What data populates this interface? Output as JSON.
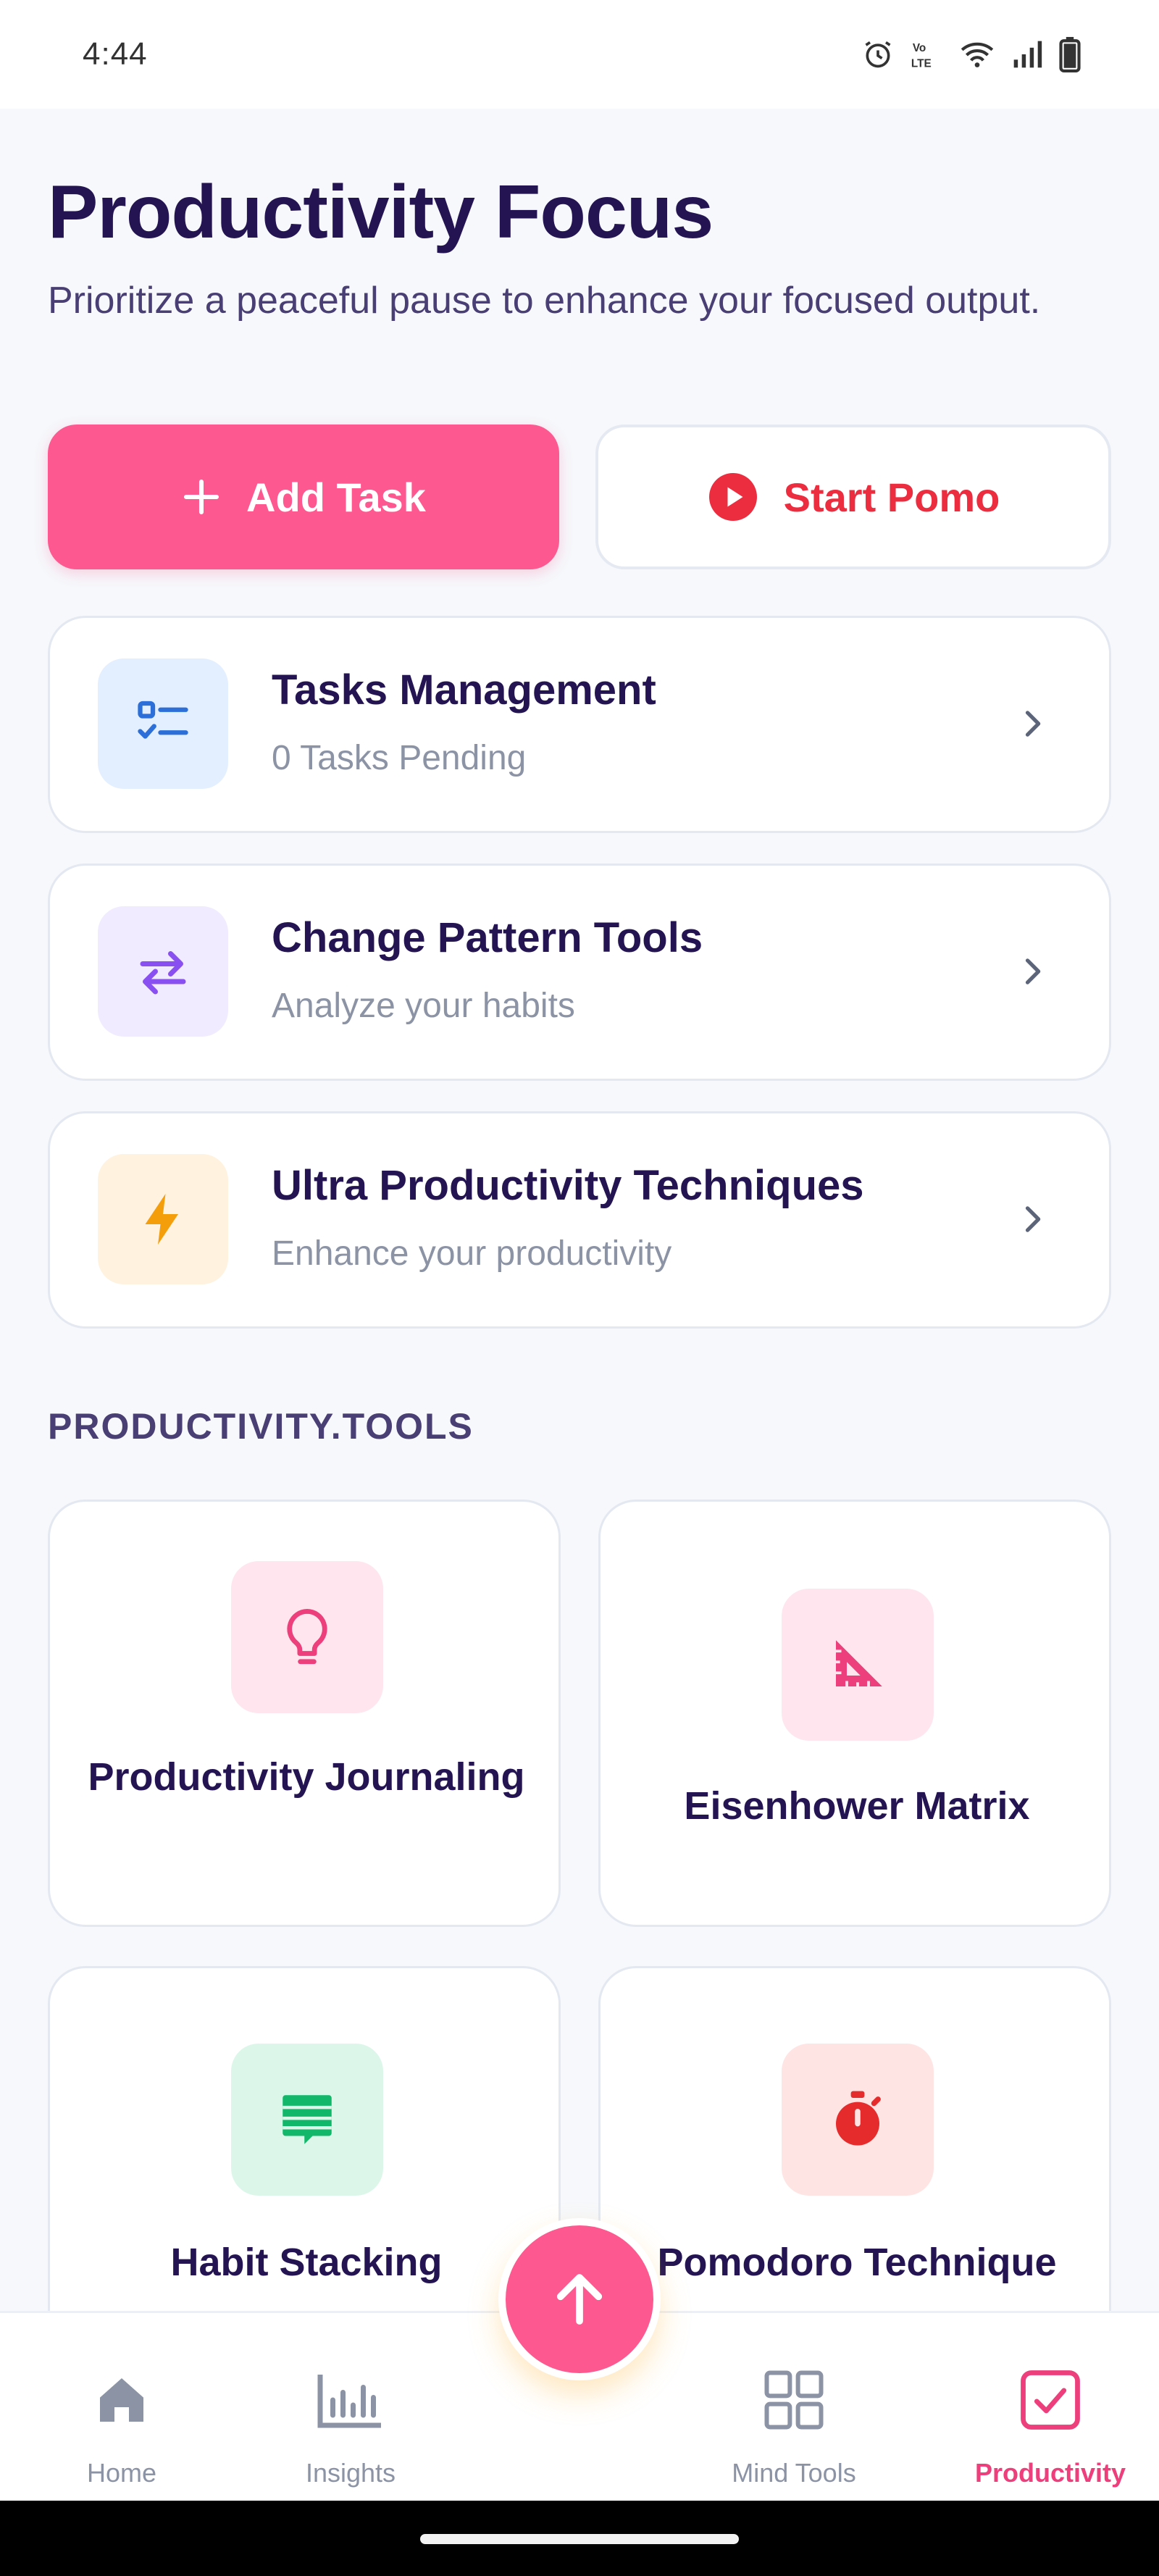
{
  "status_bar": {
    "time": "4:44",
    "icons": [
      "alarm-icon",
      "volte-icon",
      "wifi-icon",
      "signal-icon",
      "battery-icon"
    ]
  },
  "header": {
    "title": "Productivity Focus",
    "subtitle": "Prioritize a peaceful pause to enhance your focused output."
  },
  "actions": {
    "add_task_label": "Add Task",
    "start_pomo_label": "Start Pomo"
  },
  "nav_cards": [
    {
      "title": "Tasks Management",
      "subtitle": "0 Tasks Pending",
      "icon": "checklist-icon",
      "icon_bg": "#e3efff",
      "icon_color": "#2c6fd8"
    },
    {
      "title": "Change Pattern Tools",
      "subtitle": "Analyze your habits",
      "icon": "swap-arrows-icon",
      "icon_bg": "#f1ebff",
      "icon_color": "#8a4ff0"
    },
    {
      "title": "Ultra Productivity Techniques",
      "subtitle": "Enhance your productivity",
      "icon": "lightning-icon",
      "icon_bg": "#fff2df",
      "icon_color": "#f59e0b"
    }
  ],
  "tools_section": {
    "label": "PRODUCTIVITY.TOOLS",
    "items": [
      {
        "label": "Productivity Journaling",
        "icon": "lightbulb-icon",
        "icon_bg": "#ffe6ee",
        "icon_color": "#ec3f7b"
      },
      {
        "label": "Eisenhower Matrix",
        "icon": "set-square-icon",
        "icon_bg": "#ffe6ee",
        "icon_color": "#ec3f7b"
      },
      {
        "label": "Habit Stacking",
        "icon": "stack-message-icon",
        "icon_bg": "#dcf7ea",
        "icon_color": "#12b76a"
      },
      {
        "label": "Pomodoro Technique",
        "icon": "stopwatch-icon",
        "icon_bg": "#ffe4e4",
        "icon_color": "#e52b2b"
      }
    ]
  },
  "bottom_nav": {
    "items": [
      {
        "label": "Home",
        "icon": "home-icon",
        "active": false
      },
      {
        "label": "Insights",
        "icon": "bar-chart-icon",
        "active": false
      },
      {
        "label": "Mind Tools",
        "icon": "grid-icon",
        "active": false
      },
      {
        "label": "Productivity",
        "icon": "checkbox-icon",
        "active": true
      }
    ]
  },
  "fab": {
    "icon": "arrow-up-icon"
  },
  "colors": {
    "accent": "#fd5890",
    "title": "#241552",
    "pomo_red": "#ec2c3f",
    "active_tab": "#ec3f7b"
  }
}
